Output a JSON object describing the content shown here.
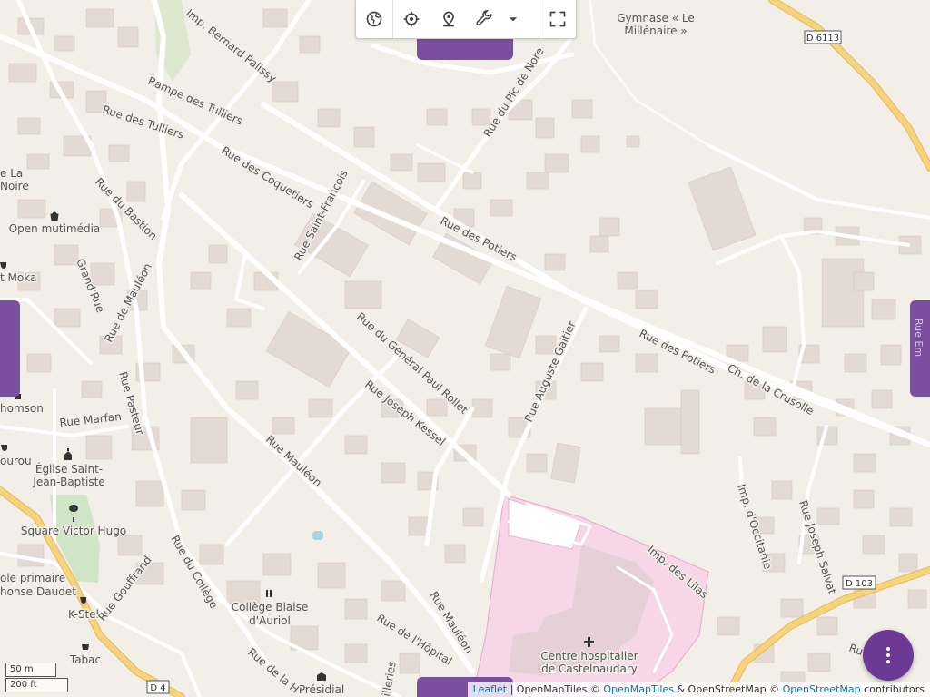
{
  "toolbar": {
    "buttons": [
      {
        "name": "globe-icon",
        "title": "Layers"
      },
      {
        "name": "locate-icon",
        "title": "Locate"
      },
      {
        "name": "pin-search-icon",
        "title": "Search place"
      },
      {
        "name": "wrench-icon",
        "title": "Tools"
      },
      {
        "name": "chevron-down-icon",
        "title": "More"
      },
      {
        "name": "fullscreen-icon",
        "title": "Fullscreen"
      }
    ]
  },
  "map": {
    "places": {
      "gymnase_l1": "Gymnase « Le",
      "gymnase_l2": "Millénaire »",
      "open_mutimedia": "Open mutimédia",
      "moka": "t Moka",
      "thomson": "homson",
      "eglise_l1": "Église Saint-",
      "eglise_l2": "Jean-Baptiste",
      "square": "Square Victor Hugo",
      "ecole_l1": "ole primaire",
      "ecole_l2": "honse Daudet",
      "kstel": "K-Stel",
      "tabac": "Tabac",
      "college_l1": "Collège Blaise",
      "college_l2": "d'Auriol",
      "presidial": "Présidial",
      "hopital_l1": "Centre hospitalier",
      "hopital_l2": "de Castelnaudary",
      "lanoire_l1": "e La",
      "lanoire_l2": "Noire",
      "ourou": "ourou"
    },
    "streets": {
      "bernard_palissy": "Imp. Bernard Palissy",
      "rampe_tulliers": "Rampe des Tulliers",
      "rue_tulliers": "Rue des Tulliers",
      "rue_coquetiers": "Rue des Coquetiers",
      "rue_saint_francois": "Rue Saint-François",
      "rue_bastion": "Rue du Bastion",
      "grand_rue": "Grand'Rue",
      "rue_mauleon_n": "Rue de Mauléon",
      "rue_pasteur": "Rue Pasteur",
      "rue_marfan": "Rue Marfan",
      "rue_pic_nore": "Rue du Pic de Nore",
      "rue_potiers_1": "Rue des Potiers",
      "rue_potiers_2": "Rue des Potiers",
      "ch_crusolle": "Ch. de la Crusolle",
      "rue_gen_rollet": "Rue du Général Paul Rollet",
      "rue_kessel": "Rue Joseph Kessel",
      "rue_auguste_gaitier": "Rue Auguste Gaitier",
      "rue_mauleon_1": "Rue Mauléon",
      "rue_mauleon_2": "Rue Mauléon",
      "rue_college": "Rue du Collège",
      "rue_gouffrand": "Rue Gouffrand",
      "rue_hopital": "Rue de l'Hôpital",
      "rue_de_la": "Rue de la H",
      "imp_lilas": "Imp. des Lilas",
      "imp_occitanie": "Imp. d'Occitanie",
      "rue_joseph_salvat": "Rue Joseph Salvat",
      "rue_edge": "Ru",
      "illeries": "illeries",
      "rue_em": "Rue Em"
    },
    "roads": {
      "d6113": "D 6113",
      "d103": "D 103",
      "d4": "D 4"
    },
    "colors": {
      "background": "#f2efe9",
      "building": "#d9d0c9",
      "road": "#ffffff",
      "primary_road": "#f7d47c",
      "hospital": "#f7d6e8",
      "park": "#cfe5c5",
      "accent": "#7b4f9d"
    }
  },
  "scale": {
    "metric": "50 m",
    "imperial": "200 ft"
  },
  "attribution": {
    "leaflet": "Leaflet",
    "sep1": " | OpenMapTiles © ",
    "openmaptiles": "OpenMapTiles",
    "sep2": " & OpenStreetMap © ",
    "openstreetmap": "OpenStreetMap",
    "contributors": " contributors"
  },
  "fab": {
    "icon": "more-vertical-icon"
  }
}
